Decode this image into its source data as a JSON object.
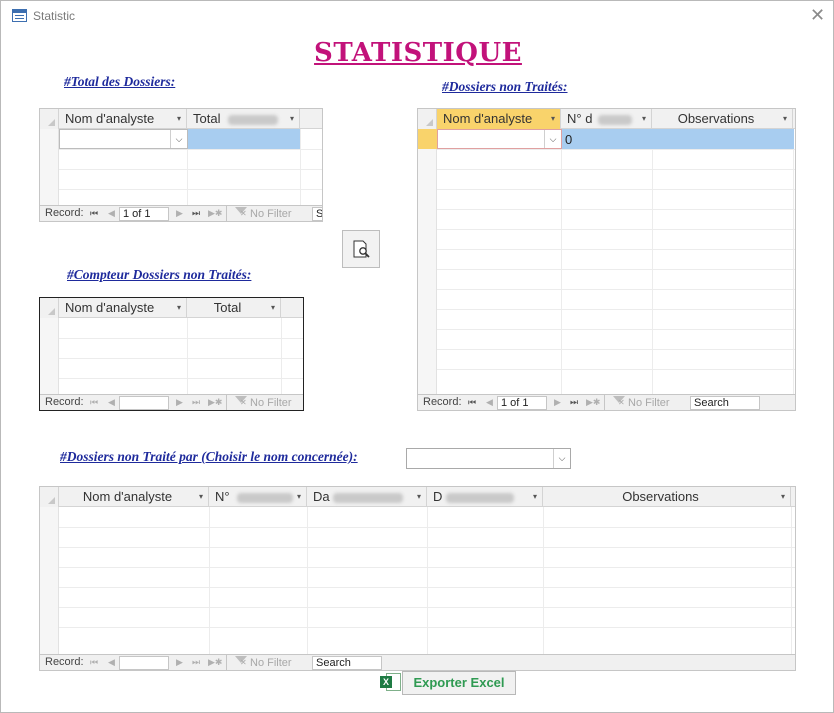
{
  "window": {
    "title": "Statistic",
    "close_glyph": "✕"
  },
  "header": {
    "title": "STATISTIQUE"
  },
  "sections": {
    "total": "#Total  des Dossiers:",
    "counter": "#Compteur  Dossiers  non Traités:",
    "non_traites": "#Dossiers  non  Traités:",
    "par_nom": "#Dossiers non Traité par (Choisir le nom concernée):"
  },
  "table_total": {
    "columns": [
      "Nom d'analyste",
      "Total"
    ],
    "nav": {
      "record_label": "Record:",
      "position": "1 of 1",
      "filter": "No Filter",
      "search": "Se"
    }
  },
  "table_counter": {
    "columns": [
      "Nom d'analyste",
      "Total"
    ],
    "nav": {
      "record_label": "Record:",
      "position": "",
      "filter": "No Filter"
    }
  },
  "table_non_traites": {
    "columns": [
      "Nom d'analyste",
      "N° d",
      "Observations"
    ],
    "rows": [
      {
        "n": "0"
      }
    ],
    "nav": {
      "record_label": "Record:",
      "position": "1 of 1",
      "filter": "No Filter",
      "search": "Search"
    }
  },
  "table_par_nom": {
    "columns": [
      "Nom d'analyste",
      "N°",
      "Da",
      "D",
      "Observations"
    ],
    "nav": {
      "record_label": "Record:",
      "position": "",
      "filter": "No Filter",
      "search": "Search"
    }
  },
  "filter_select": {
    "value": ""
  },
  "export": {
    "label": "Exporter Excel",
    "icon_letter": "X"
  },
  "icons": {
    "dropdown": "⌵",
    "col_arrow": "▾",
    "first": "⏮",
    "prev": "◀",
    "next": "▶",
    "last": "⏭",
    "new": "▶✱"
  },
  "colors": {
    "title": "#c2127a",
    "labels": "#1e2a9c",
    "selected_header": "#f9d36b",
    "row_highlight": "#a8cdf0",
    "excel_green": "#2f9a52"
  }
}
